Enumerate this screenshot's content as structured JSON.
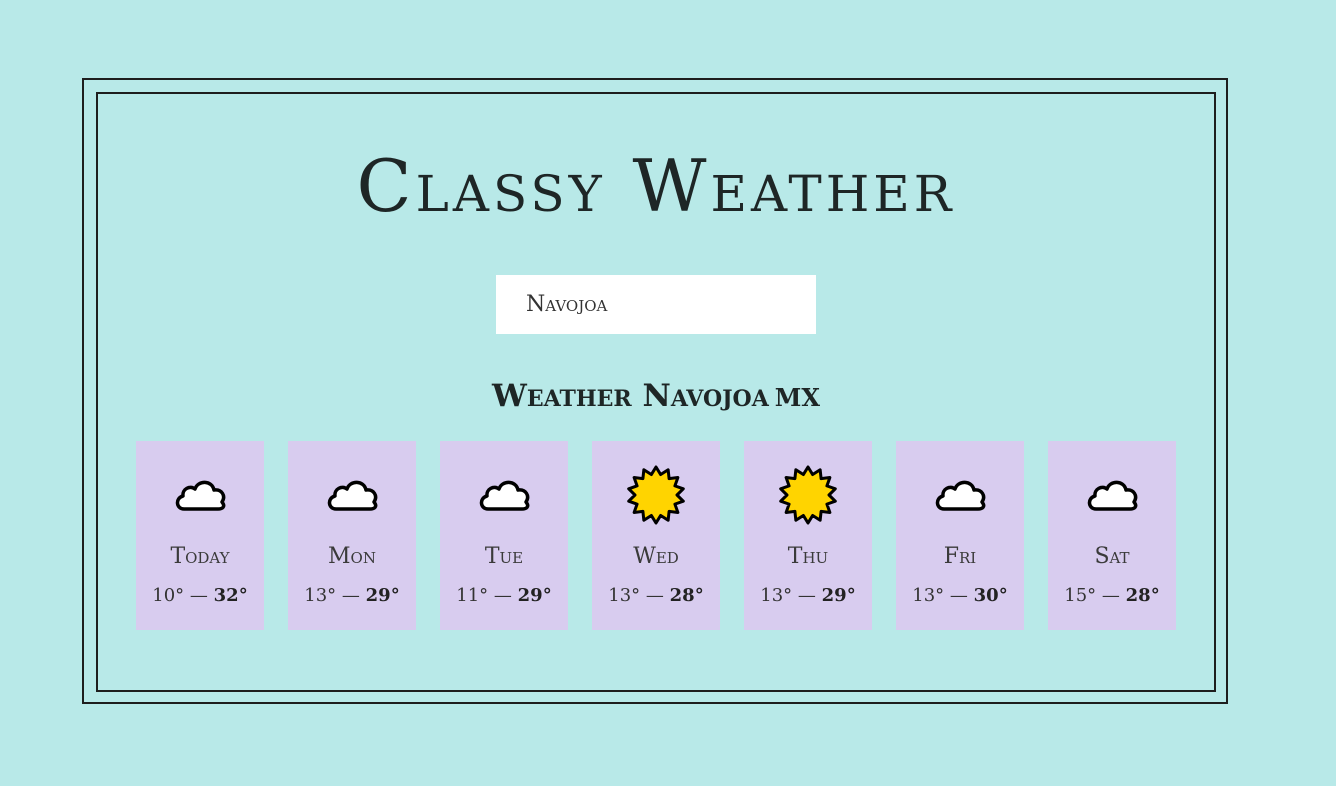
{
  "app": {
    "title": "Classy Weather"
  },
  "search": {
    "value": "Navojoa"
  },
  "location": {
    "heading": "Weather Navojoa",
    "country": "MX"
  },
  "colors": {
    "background": "#b8e9e8",
    "card": "#d8ccef",
    "sun": "#ffd400"
  },
  "forecast": [
    {
      "day": "Today",
      "icon": "cloud-icon",
      "min": "10°",
      "separator": "—",
      "max": "32°"
    },
    {
      "day": "Mon",
      "icon": "cloud-icon",
      "min": "13°",
      "separator": "—",
      "max": "29°"
    },
    {
      "day": "Tue",
      "icon": "cloud-icon",
      "min": "11°",
      "separator": "—",
      "max": "29°"
    },
    {
      "day": "Wed",
      "icon": "sun-icon",
      "min": "13°",
      "separator": "—",
      "max": "28°"
    },
    {
      "day": "Thu",
      "icon": "sun-icon",
      "min": "13°",
      "separator": "—",
      "max": "29°"
    },
    {
      "day": "Fri",
      "icon": "cloud-icon",
      "min": "13°",
      "separator": "—",
      "max": "30°"
    },
    {
      "day": "Sat",
      "icon": "cloud-icon",
      "min": "15°",
      "separator": "—",
      "max": "28°"
    }
  ]
}
